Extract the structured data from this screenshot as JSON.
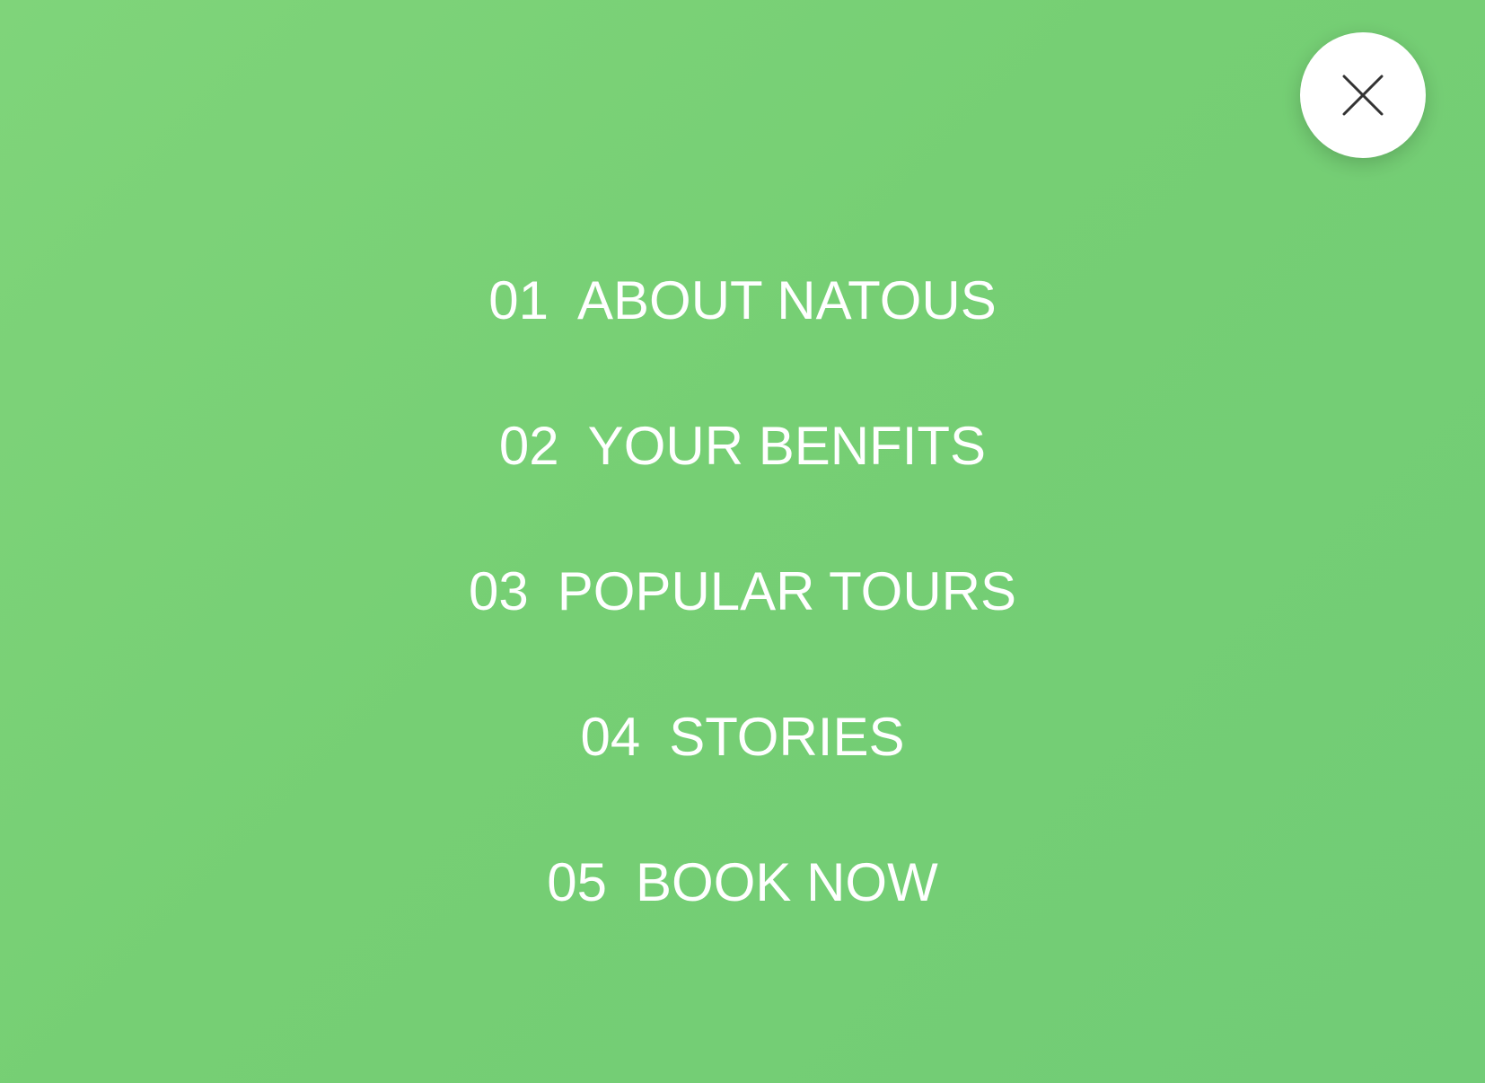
{
  "colors": {
    "overlay_start": "#7fd47a",
    "overlay_end": "#71cc76",
    "text": "#ffffff",
    "close_button_bg": "#ffffff",
    "close_icon": "#333333"
  },
  "close_button": {
    "icon": "close-icon"
  },
  "nav": {
    "items": [
      {
        "num": "01",
        "label": "ABOUT NATOUS"
      },
      {
        "num": "02",
        "label": "YOUR BENFITS"
      },
      {
        "num": "03",
        "label": "POPULAR TOURS"
      },
      {
        "num": "04",
        "label": "STORIES"
      },
      {
        "num": "05",
        "label": "BOOK NOW"
      }
    ]
  }
}
